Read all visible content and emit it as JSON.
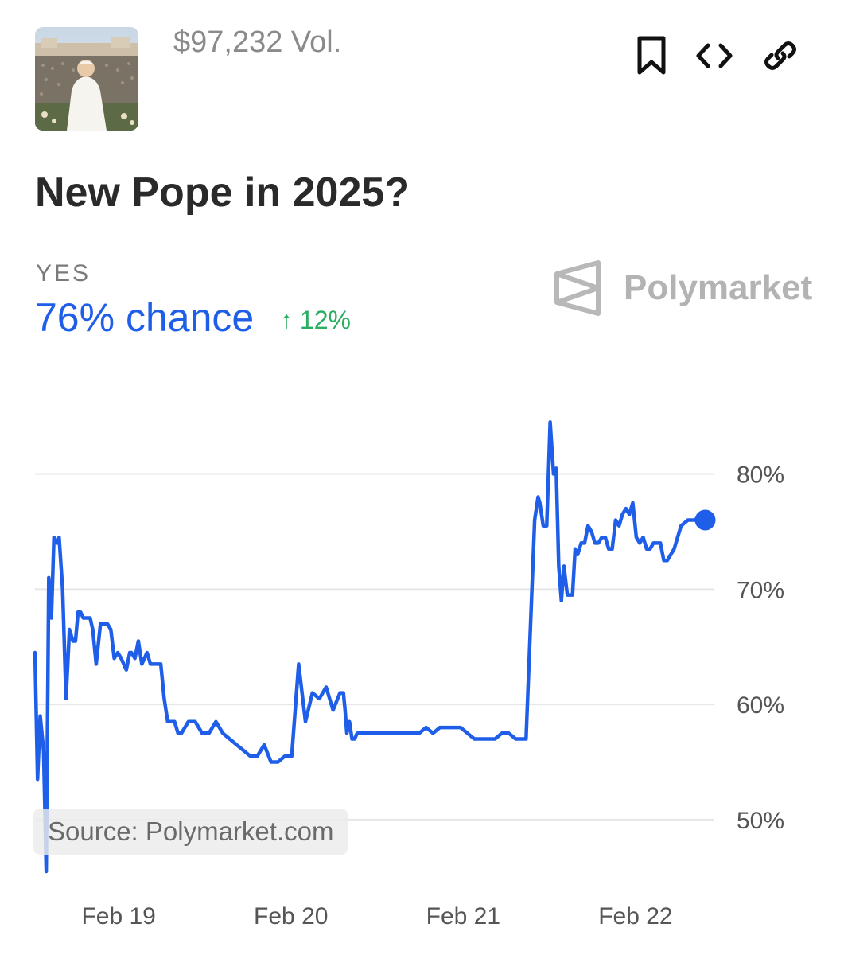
{
  "header": {
    "volume": "$97,232 Vol.",
    "icons": [
      "bookmark-icon",
      "embed-code-icon",
      "link-icon"
    ]
  },
  "market": {
    "title": "New Pope in 2025?",
    "outcome_label": "YES",
    "chance": "76% chance",
    "change": "↑ 12%"
  },
  "brand": {
    "name": "Polymarket"
  },
  "source": "Source: Polymarket.com",
  "colors": {
    "line": "#1f5ee8",
    "gain": "#27ae60",
    "grid": "#e6e6e6",
    "muted_text": "#8a8a8a"
  },
  "chart_data": {
    "type": "line",
    "title": "",
    "xlabel": "",
    "ylabel": "",
    "x_ticks": [
      "Feb 19",
      "Feb 20",
      "Feb 21",
      "Feb 22"
    ],
    "x_tick_positions_days": [
      0,
      1,
      2,
      3
    ],
    "x_range_days": [
      -0.27,
      3.71
    ],
    "y_ticks": [
      "50%",
      "60%",
      "70%",
      "80%"
    ],
    "y_tick_values": [
      50,
      60,
      70,
      80
    ],
    "ylim": [
      45.5,
      84.6
    ],
    "grid": true,
    "end_marker": true,
    "series": [
      {
        "x_days": [
          -0.27,
          -0.255,
          -0.24,
          -0.22,
          -0.205,
          -0.19,
          -0.175,
          -0.16,
          -0.14,
          -0.13,
          -0.11,
          -0.09,
          -0.07,
          -0.05,
          -0.035,
          -0.02,
          -0.005,
          0.01,
          0.03,
          0.05,
          0.065,
          0.085,
          0.11,
          0.13,
          0.15,
          0.17,
          0.19,
          0.21,
          0.23,
          0.26,
          0.28,
          0.29,
          0.31,
          0.33,
          0.35,
          0.38,
          0.4,
          0.42,
          0.44,
          0.46,
          0.48,
          0.5,
          0.52,
          0.54,
          0.56,
          0.58,
          0.62,
          0.66,
          0.7,
          0.74,
          0.78,
          0.82,
          0.86,
          0.9,
          0.94,
          0.98,
          1.02,
          1.06,
          1.1,
          1.14,
          1.18,
          1.22,
          1.26,
          1.3,
          1.34,
          1.38,
          1.42,
          1.46,
          1.5,
          1.52,
          1.53,
          1.54,
          1.555,
          1.57,
          1.585,
          1.6,
          1.615,
          1.63,
          1.65,
          1.66,
          1.67,
          1.69,
          1.72,
          1.76,
          1.8,
          1.84,
          1.88,
          1.92,
          1.96,
          2,
          2.04,
          2.08,
          2.12,
          2.16,
          2.2,
          2.24,
          2.28,
          2.32,
          2.36,
          2.4,
          2.44,
          2.48,
          2.52,
          2.58,
          2.63,
          2.65,
          2.66,
          2.68,
          2.7,
          2.72,
          2.74,
          2.755,
          2.77,
          2.785,
          2.8,
          2.82,
          2.835,
          2.85,
          2.865,
          2.88,
          2.9,
          2.92,
          2.94,
          2.96,
          2.98,
          3,
          3.02,
          3.04,
          3.06,
          3.08,
          3.1,
          3.12,
          3.14,
          3.16,
          3.18,
          3.2,
          3.22,
          3.24,
          3.26,
          3.28,
          3.3,
          3.32,
          3.34,
          3.36,
          3.38,
          3.4,
          3.44,
          3.48,
          3.52,
          3.56,
          3.6,
          3.62,
          3.64,
          3.66,
          3.68,
          3.71
        ],
        "values": [
          64.5,
          53.5,
          59.0,
          56.0,
          45.5,
          71.0,
          67.5,
          74.5,
          74.0,
          74.5,
          70.0,
          60.5,
          66.5,
          65.5,
          65.5,
          68.0,
          68.0,
          67.5,
          67.5,
          67.5,
          66.5,
          63.5,
          67.0,
          67.0,
          67.0,
          66.5,
          64.0,
          64.5,
          64.0,
          63.0,
          64.5,
          64.5,
          64.0,
          65.5,
          63.5,
          64.5,
          63.5,
          63.5,
          63.5,
          63.5,
          60.5,
          58.5,
          58.5,
          58.5,
          57.5,
          57.5,
          58.5,
          58.5,
          57.5,
          57.5,
          58.5,
          57.5,
          57.0,
          56.5,
          56.0,
          55.5,
          55.5,
          56.5,
          55.0,
          55.0,
          55.5,
          55.5,
          63.5,
          58.5,
          61.0,
          60.5,
          61.5,
          59.5,
          61.0,
          61.0,
          59.5,
          57.5,
          58.5,
          57.0,
          57.0,
          57.5,
          57.5,
          57.5,
          57.5,
          57.5,
          57.5,
          57.5,
          57.5,
          57.5,
          57.5,
          57.5,
          57.5,
          57.5,
          57.5,
          58.0,
          57.5,
          58.0,
          58.0,
          58.0,
          58.0,
          57.5,
          57.0,
          57.0,
          57.0,
          57.0,
          57.5,
          57.5,
          57.0,
          57.0,
          76.0,
          78.0,
          77.5,
          75.5,
          75.5,
          84.5,
          80.0,
          80.5,
          72.0,
          69.0,
          72.0,
          69.5,
          69.5,
          69.5,
          73.5,
          73.0,
          74.0,
          74.0,
          75.5,
          75.0,
          74.0,
          74.0,
          74.5,
          74.5,
          73.5,
          73.5,
          76.0,
          75.5,
          76.5,
          77.0,
          76.5,
          77.5,
          74.5,
          74.0,
          74.5,
          73.5,
          73.5,
          74.0,
          74.0,
          74.0,
          72.5,
          72.5,
          73.5,
          75.5,
          76.0,
          76.0,
          76.5,
          76.0
        ]
      }
    ]
  }
}
